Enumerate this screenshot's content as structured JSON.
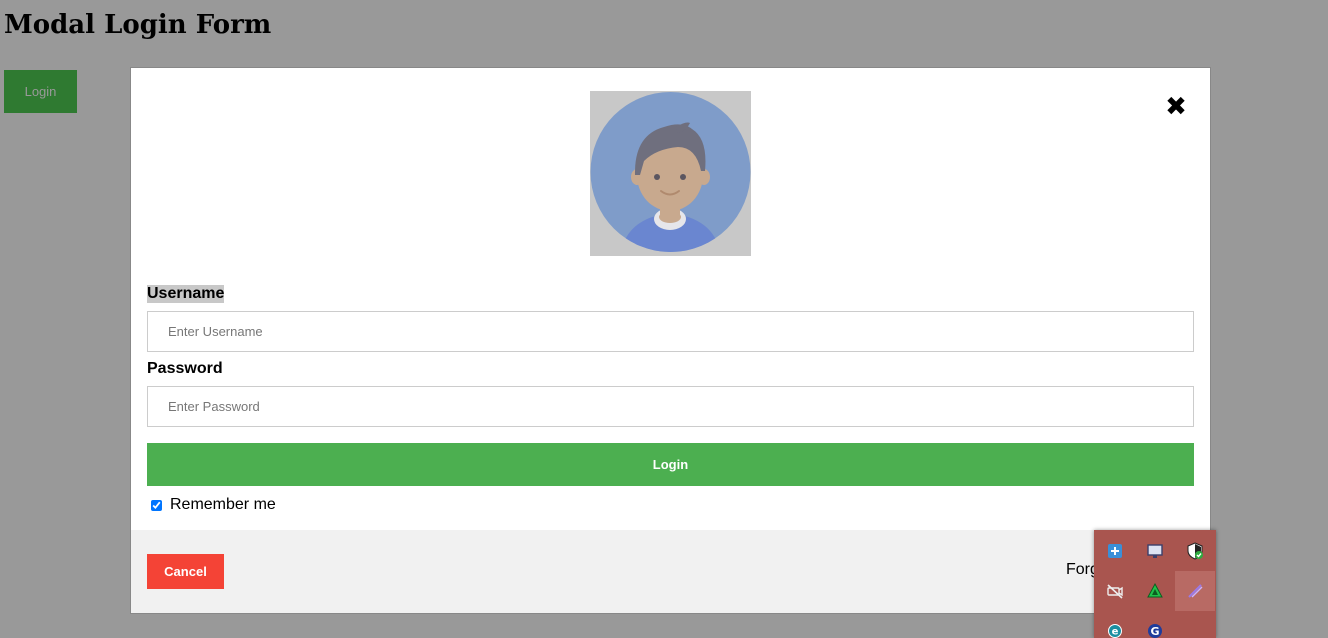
{
  "page": {
    "title": "Modal Login Form",
    "open_button_label": "Login"
  },
  "modal": {
    "close_symbol": "✖",
    "avatar_icon": "avatar-icon",
    "username_label": "Username",
    "username_placeholder": "Enter Username",
    "username_value": "",
    "password_label": "Password",
    "password_placeholder": "Enter Password",
    "password_value": "",
    "submit_label": "Login",
    "remember_label": "Remember me",
    "remember_checked": true,
    "footer": {
      "cancel_label": "Cancel",
      "forgot_text": "Forgot password?"
    }
  },
  "tray": {
    "icons": [
      "network-app-icon",
      "monitor-icon",
      "shield-check-icon",
      "no-camera-icon",
      "triangle-app-icon",
      "pen-icon",
      "edge-browser-icon",
      "g-app-icon"
    ]
  },
  "colors": {
    "backdrop": "#999999",
    "open_button": "#2f7a31",
    "submit_button": "#4caf50",
    "cancel_button": "#f44336",
    "footer_bg": "#f1f1f1",
    "avatar_circle": "#7f9cc9",
    "tray_bg": "#a9554f"
  }
}
